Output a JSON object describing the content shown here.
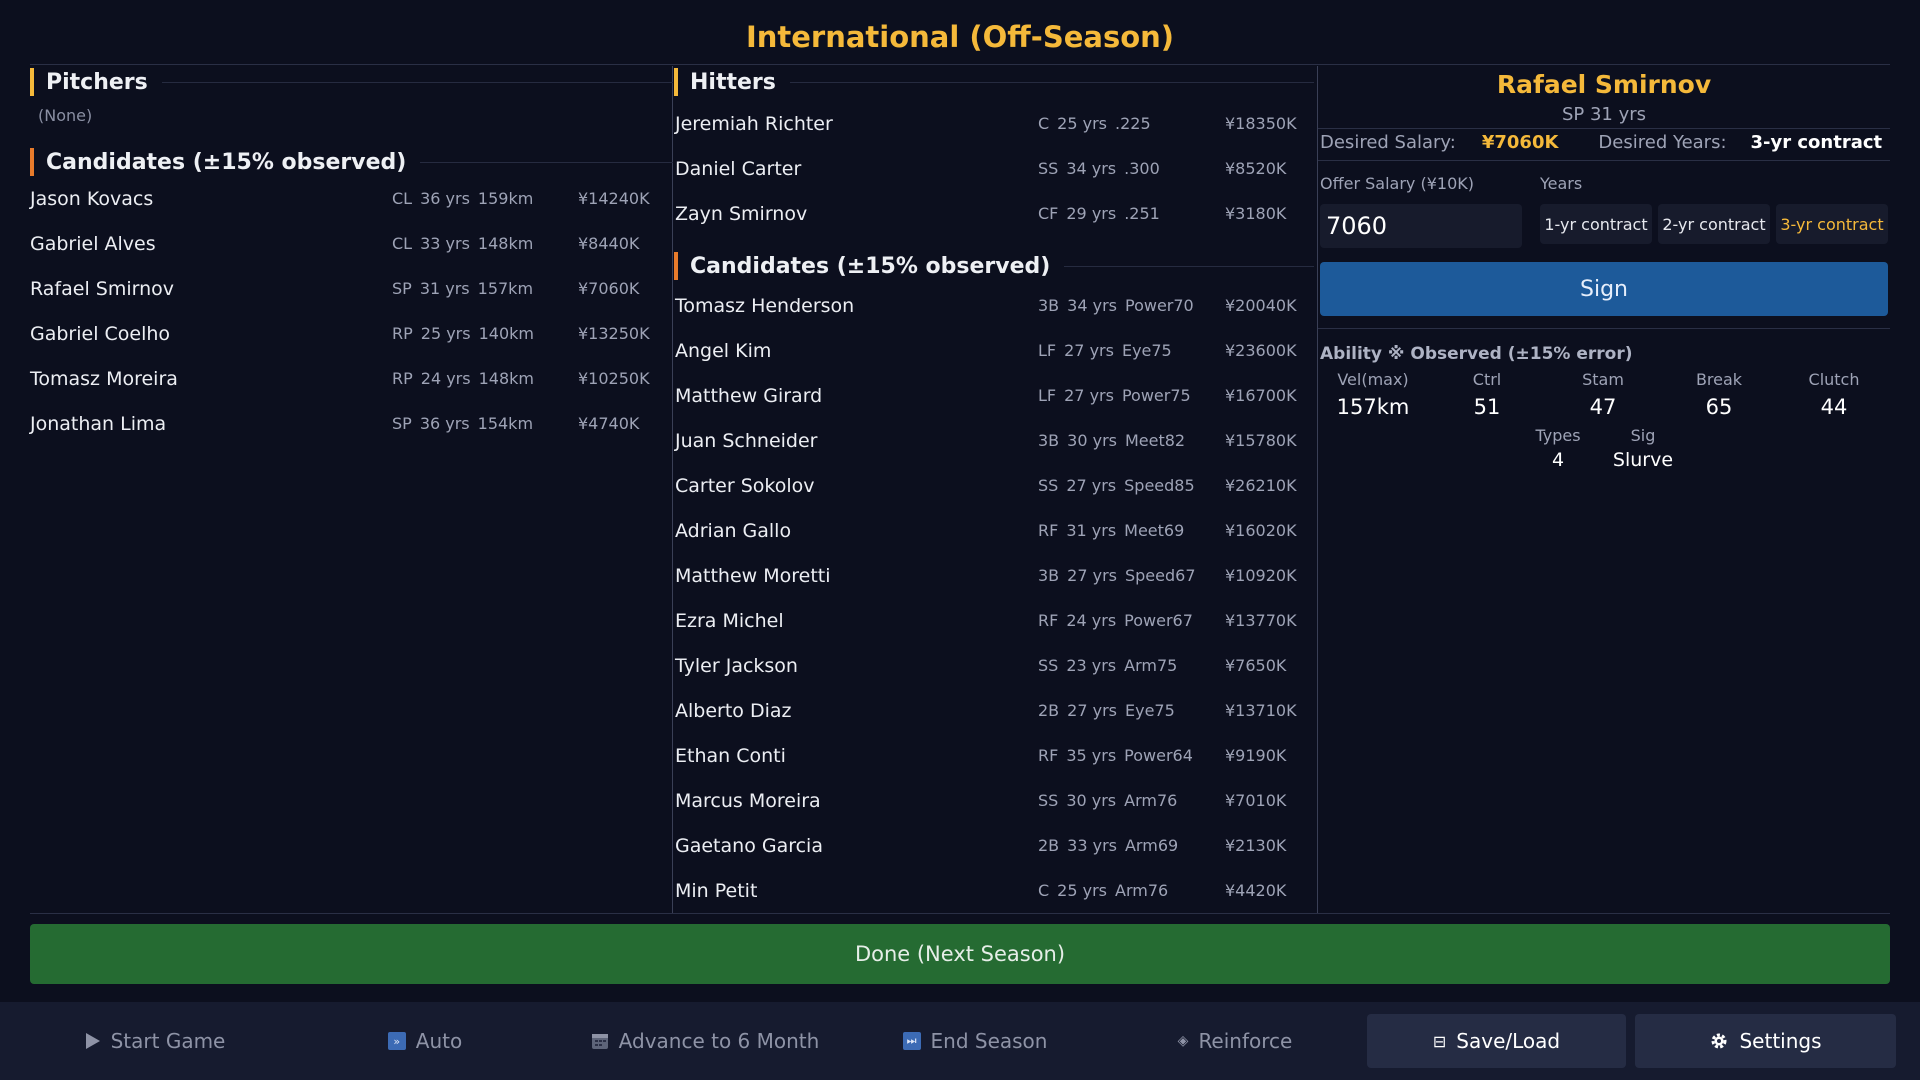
{
  "title": "International (Off-Season)",
  "pitchers": {
    "heading": "Pitchers",
    "none_text": "(None)",
    "candidates_heading": "Candidates (±15% observed)",
    "candidates": [
      {
        "name": "Jason Kovacs",
        "pos": "CL",
        "age": "36 yrs",
        "stat": "159km",
        "salary": "¥14240K"
      },
      {
        "name": "Gabriel Alves",
        "pos": "CL",
        "age": "33 yrs",
        "stat": "148km",
        "salary": "¥8440K"
      },
      {
        "name": "Rafael Smirnov",
        "pos": "SP",
        "age": "31 yrs",
        "stat": "157km",
        "salary": "¥7060K"
      },
      {
        "name": "Gabriel Coelho",
        "pos": "RP",
        "age": "25 yrs",
        "stat": "140km",
        "salary": "¥13250K"
      },
      {
        "name": "Tomasz Moreira",
        "pos": "RP",
        "age": "24 yrs",
        "stat": "148km",
        "salary": "¥10250K"
      },
      {
        "name": "Jonathan Lima",
        "pos": "SP",
        "age": "36 yrs",
        "stat": "154km",
        "salary": "¥4740K"
      }
    ]
  },
  "hitters": {
    "heading": "Hitters",
    "roster": [
      {
        "name": "Jeremiah Richter",
        "pos": "C",
        "age": "25 yrs",
        "stat": ".225",
        "salary": "¥18350K"
      },
      {
        "name": "Daniel Carter",
        "pos": "SS",
        "age": "34 yrs",
        "stat": ".300",
        "salary": "¥8520K"
      },
      {
        "name": "Zayn Smirnov",
        "pos": "CF",
        "age": "29 yrs",
        "stat": ".251",
        "salary": "¥3180K"
      }
    ],
    "candidates_heading": "Candidates (±15% observed)",
    "candidates": [
      {
        "name": "Tomasz Henderson",
        "pos": "3B",
        "age": "34 yrs",
        "stat": "Power70",
        "salary": "¥20040K"
      },
      {
        "name": "Angel Kim",
        "pos": "LF",
        "age": "27 yrs",
        "stat": "Eye75",
        "salary": "¥23600K"
      },
      {
        "name": "Matthew Girard",
        "pos": "LF",
        "age": "27 yrs",
        "stat": "Power75",
        "salary": "¥16700K"
      },
      {
        "name": "Juan Schneider",
        "pos": "3B",
        "age": "30 yrs",
        "stat": "Meet82",
        "salary": "¥15780K"
      },
      {
        "name": "Carter Sokolov",
        "pos": "SS",
        "age": "27 yrs",
        "stat": "Speed85",
        "salary": "¥26210K"
      },
      {
        "name": "Adrian Gallo",
        "pos": "RF",
        "age": "31 yrs",
        "stat": "Meet69",
        "salary": "¥16020K"
      },
      {
        "name": "Matthew Moretti",
        "pos": "3B",
        "age": "27 yrs",
        "stat": "Speed67",
        "salary": "¥10920K"
      },
      {
        "name": "Ezra Michel",
        "pos": "RF",
        "age": "24 yrs",
        "stat": "Power67",
        "salary": "¥13770K"
      },
      {
        "name": "Tyler Jackson",
        "pos": "SS",
        "age": "23 yrs",
        "stat": "Arm75",
        "salary": "¥7650K"
      },
      {
        "name": "Alberto Diaz",
        "pos": "2B",
        "age": "27 yrs",
        "stat": "Eye75",
        "salary": "¥13710K"
      },
      {
        "name": "Ethan Conti",
        "pos": "RF",
        "age": "35 yrs",
        "stat": "Power64",
        "salary": "¥9190K"
      },
      {
        "name": "Marcus Moreira",
        "pos": "SS",
        "age": "30 yrs",
        "stat": "Arm76",
        "salary": "¥7010K"
      },
      {
        "name": "Gaetano Garcia",
        "pos": "2B",
        "age": "33 yrs",
        "stat": "Arm69",
        "salary": "¥2130K"
      },
      {
        "name": "Min Petit",
        "pos": "C",
        "age": "25 yrs",
        "stat": "Arm76",
        "salary": "¥4420K"
      }
    ]
  },
  "detail": {
    "name": "Rafael Smirnov",
    "sub": "SP  31 yrs",
    "desired_salary_label": "Desired Salary:",
    "desired_salary": "¥7060K",
    "desired_years_label": "Desired Years:",
    "desired_years": "3-yr contract",
    "offer_label": "Offer Salary (¥10K)",
    "years_label": "Years",
    "offer_value": "7060",
    "year_options": [
      "1-yr contract",
      "2-yr contract",
      "3-yr contract"
    ],
    "selected_year_index": 2,
    "sign_label": "Sign",
    "ability_title": "Ability ※ Observed (±15% error)",
    "stats": [
      {
        "label": "Vel(max)",
        "value": "157km"
      },
      {
        "label": "Ctrl",
        "value": "51"
      },
      {
        "label": "Stam",
        "value": "47"
      },
      {
        "label": "Break",
        "value": "65"
      },
      {
        "label": "Clutch",
        "value": "44"
      }
    ],
    "stats2": [
      {
        "label": "Types",
        "value": "4"
      },
      {
        "label": "Sig",
        "value": "Slurve"
      }
    ]
  },
  "done_label": "Done (Next Season)",
  "toolbar": {
    "start_game": "Start Game",
    "auto": "Auto",
    "advance": "Advance to 6 Month",
    "end_season": "End Season",
    "reinforce": "Reinforce",
    "save_load": "Save/Load",
    "settings": "Settings"
  },
  "colors": {
    "accent": "#f5b93a",
    "sign": "#1d5a9a",
    "done": "#256b32",
    "background": "#0c0f1e"
  }
}
